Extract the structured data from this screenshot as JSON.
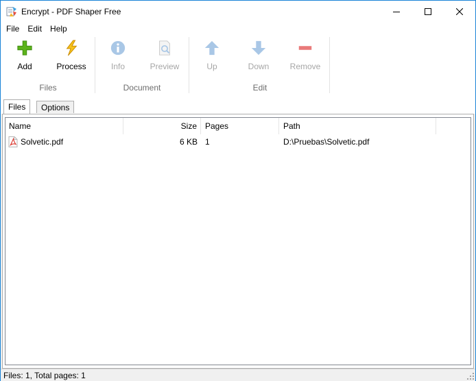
{
  "window": {
    "title": "Encrypt - PDF Shaper Free"
  },
  "menu": {
    "items": [
      "File",
      "Edit",
      "Help"
    ]
  },
  "ribbon": {
    "groups": [
      {
        "label": "Files",
        "tools": [
          {
            "label": "Add",
            "icon": "plus-icon",
            "enabled": true
          },
          {
            "label": "Process",
            "icon": "lightning-icon",
            "enabled": true
          }
        ]
      },
      {
        "label": "Document",
        "tools": [
          {
            "label": "Info",
            "icon": "info-icon",
            "enabled": false
          },
          {
            "label": "Preview",
            "icon": "preview-icon",
            "enabled": false
          }
        ]
      },
      {
        "label": "Edit",
        "tools": [
          {
            "label": "Up",
            "icon": "arrow-up-icon",
            "enabled": false
          },
          {
            "label": "Down",
            "icon": "arrow-down-icon",
            "enabled": false
          },
          {
            "label": "Remove",
            "icon": "minus-icon",
            "enabled": false
          }
        ]
      }
    ]
  },
  "tabs": [
    {
      "label": "Files",
      "active": true
    },
    {
      "label": "Options",
      "active": false
    }
  ],
  "file_list": {
    "columns": [
      "Name",
      "Size",
      "Pages",
      "Path"
    ],
    "rows": [
      {
        "name": "Solvetic.pdf",
        "size": "6 KB",
        "pages": "1",
        "path": "D:\\Pruebas\\Solvetic.pdf"
      }
    ]
  },
  "status": {
    "text": "Files: 1, Total pages: 1"
  },
  "colors": {
    "accent_border": "#1883d7",
    "add_green": "#5cb31b",
    "process_yellow": "#f6c21b",
    "disabled_blue": "#a9c7e6",
    "remove_red": "#e97a7a"
  }
}
